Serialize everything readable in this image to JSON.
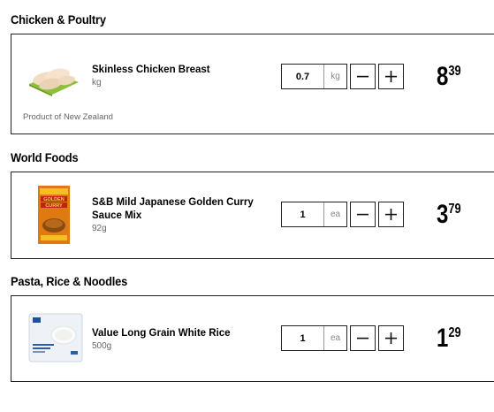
{
  "sections": [
    {
      "title": "Chicken & Poultry",
      "product": {
        "name": "Skinless Chicken Breast",
        "unit": "kg",
        "origin": "Product of New Zealand",
        "quantity": "0.7",
        "quantity_unit": "kg",
        "price_dollars": "8",
        "price_cents": "39",
        "image_icon": "chicken-breast-image"
      }
    },
    {
      "title": "World Foods",
      "product": {
        "name": "S&B Mild Japanese Golden Curry Sauce Mix",
        "unit": "92g",
        "quantity": "1",
        "quantity_unit": "ea",
        "price_dollars": "3",
        "price_cents": "79",
        "image_icon": "curry-box-image",
        "image_label": "GOLDEN CURRY"
      }
    },
    {
      "title": "Pasta, Rice & Noodles",
      "product": {
        "name": "Value Long Grain White Rice",
        "unit": "500g",
        "quantity": "1",
        "quantity_unit": "ea",
        "price_dollars": "1",
        "price_cents": "29",
        "image_icon": "rice-bag-image"
      }
    }
  ],
  "controls": {
    "minus_icon": "minus-icon",
    "plus_icon": "plus-icon"
  }
}
